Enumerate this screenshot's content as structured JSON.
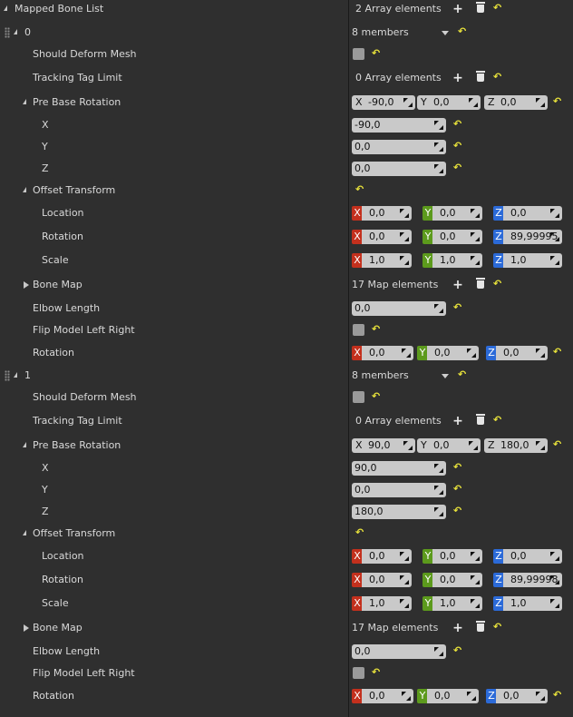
{
  "root": {
    "label": "Mapped Bone List",
    "summary": "2 Array elements"
  },
  "elements": [
    {
      "index": "0",
      "members": "8 members",
      "should_deform_label": "Should Deform Mesh",
      "tracking_label": "Tracking Tag Limit",
      "tracking_value": "0 Array elements",
      "pre_base_label": "Pre Base Rotation",
      "pre_base": {
        "x": "-90,0",
        "y": "0,0",
        "z": "0,0"
      },
      "pb_x_label": "X",
      "pb_y_label": "Y",
      "pb_z_label": "Z",
      "offset_label": "Offset Transform",
      "location_label": "Location",
      "location": {
        "x": "0,0",
        "y": "0,0",
        "z": "0,0"
      },
      "rotation_label": "Rotation",
      "rotation": {
        "x": "0,0",
        "y": "0,0",
        "z": "89,99995"
      },
      "scale_label": "Scale",
      "scale": {
        "x": "1,0",
        "y": "1,0",
        "z": "1,0"
      },
      "bone_map_label": "Bone Map",
      "bone_map_value": "17 Map elements",
      "elbow_label": "Elbow Length",
      "elbow_value": "0,0",
      "flip_label": "Flip Model Left Right",
      "rot2_label": "Rotation",
      "rot2": {
        "x": "0,0",
        "y": "0,0",
        "z": "0,0"
      }
    },
    {
      "index": "1",
      "members": "8 members",
      "should_deform_label": "Should Deform Mesh",
      "tracking_label": "Tracking Tag Limit",
      "tracking_value": "0 Array elements",
      "pre_base_label": "Pre Base Rotation",
      "pre_base": {
        "x": "90,0",
        "y": "0,0",
        "z": "180,0"
      },
      "pb_x_label": "X",
      "pb_y_label": "Y",
      "pb_z_label": "Z",
      "offset_label": "Offset Transform",
      "location_label": "Location",
      "location": {
        "x": "0,0",
        "y": "0,0",
        "z": "0,0"
      },
      "rotation_label": "Rotation",
      "rotation": {
        "x": "0,0",
        "y": "0,0",
        "z": "89,99998"
      },
      "scale_label": "Scale",
      "scale": {
        "x": "1,0",
        "y": "1,0",
        "z": "1,0"
      },
      "bone_map_label": "Bone Map",
      "bone_map_value": "17 Map elements",
      "elbow_label": "Elbow Length",
      "elbow_value": "0,0",
      "flip_label": "Flip Model Left Right",
      "rot2_label": "Rotation",
      "rot2": {
        "x": "0,0",
        "y": "0,0",
        "z": "0,0"
      }
    }
  ],
  "axis_letters": {
    "x": "X",
    "y": "Y",
    "z": "Z"
  },
  "icons": {
    "add": "plus-icon",
    "remove": "trash-icon",
    "reset": "reset-arrow-icon"
  },
  "colors": {
    "axis_x": "#c3301d",
    "axis_y": "#5c9a1c",
    "axis_z": "#2b6ad8",
    "reset": "#e8e23b"
  }
}
